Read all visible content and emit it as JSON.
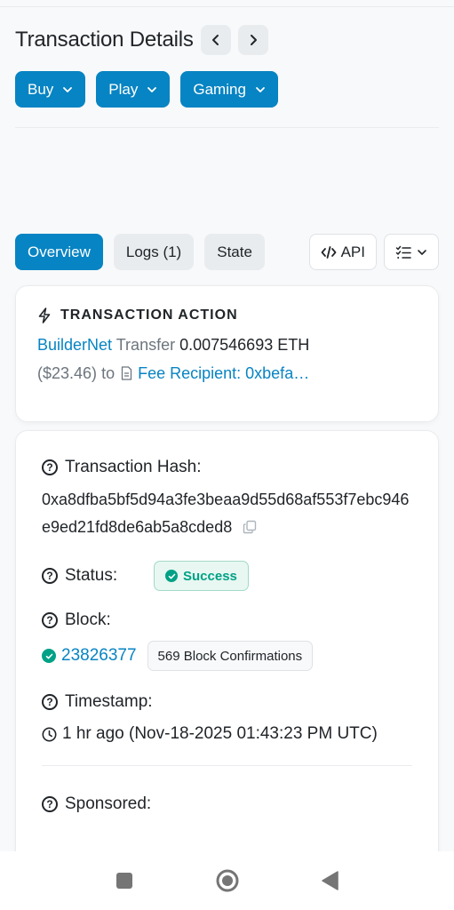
{
  "header": {
    "title": "Transaction Details"
  },
  "filters": [
    {
      "label": "Buy"
    },
    {
      "label": "Play"
    },
    {
      "label": "Gaming"
    }
  ],
  "tabs": [
    {
      "label": "Overview",
      "active": true
    },
    {
      "label": "Logs (1)",
      "active": false
    },
    {
      "label": "State",
      "active": false
    }
  ],
  "tools": {
    "api_label": "API"
  },
  "action": {
    "heading": "TRANSACTION ACTION",
    "from": "BuilderNet",
    "verb": "Transfer",
    "amount": "0.007546693 ETH",
    "usd": "($23.46)",
    "to_word": "to",
    "recipient": "Fee Recipient: 0xbefa…"
  },
  "details": {
    "hash_label": "Transaction Hash:",
    "hash_value": "0xa8dfba5bf5d94a3fe3beaa9d55d68af553f7ebc946e9ed21fd8de6ab5a8cded8",
    "status_label": "Status:",
    "status_value": "Success",
    "block_label": "Block:",
    "block_number": "23826377",
    "block_confirmations": "569 Block Confirmations",
    "timestamp_label": "Timestamp:",
    "timestamp_value": "1 hr ago (Nov-18-2025 01:43:23 PM UTC)",
    "sponsored_label": "Sponsored:"
  },
  "colors": {
    "accent": "#0784c3",
    "success": "#00a186"
  }
}
